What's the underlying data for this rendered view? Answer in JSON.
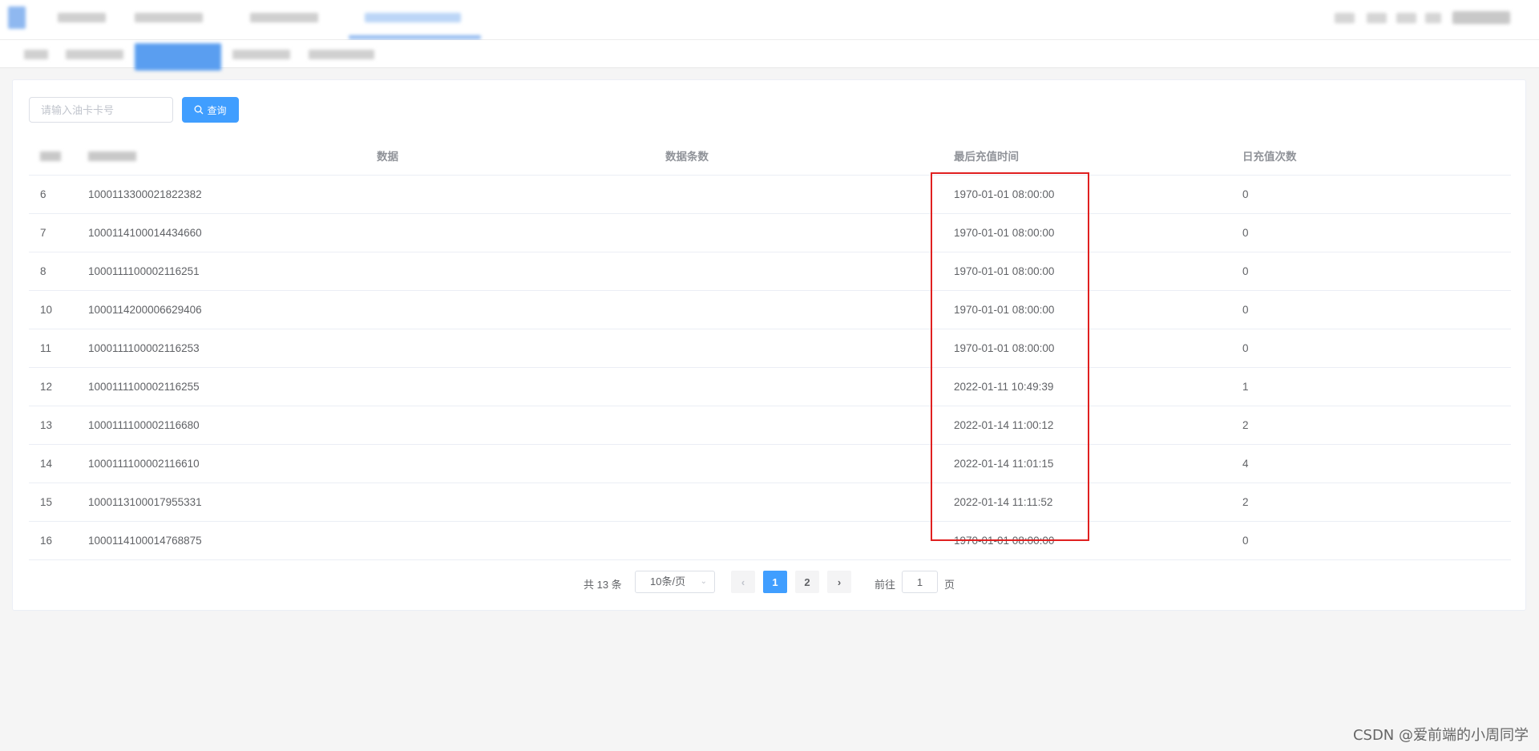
{
  "search": {
    "placeholder": "请输入油卡卡号",
    "button_label": "查询",
    "button_icon": "search-icon"
  },
  "table": {
    "columns": [
      "",
      "",
      "数据",
      "数据条数",
      "最后充值时间",
      "日充值次数"
    ],
    "rows": [
      {
        "index": "6",
        "card": "1000113300021822382",
        "data": "",
        "count": "",
        "last_time": "1970-01-01 08:00:00",
        "daily": "0"
      },
      {
        "index": "7",
        "card": "1000114100014434660",
        "data": "",
        "count": "",
        "last_time": "1970-01-01 08:00:00",
        "daily": "0"
      },
      {
        "index": "8",
        "card": "1000111100002116251",
        "data": "",
        "count": "",
        "last_time": "1970-01-01 08:00:00",
        "daily": "0"
      },
      {
        "index": "10",
        "card": "1000114200006629406",
        "data": "",
        "count": "",
        "last_time": "1970-01-01 08:00:00",
        "daily": "0"
      },
      {
        "index": "11",
        "card": "1000111100002116253",
        "data": "",
        "count": "",
        "last_time": "1970-01-01 08:00:00",
        "daily": "0"
      },
      {
        "index": "12",
        "card": "1000111100002116255",
        "data": "",
        "count": "",
        "last_time": "2022-01-11 10:49:39",
        "daily": "1"
      },
      {
        "index": "13",
        "card": "1000111100002116680",
        "data": "",
        "count": "",
        "last_time": "2022-01-14 11:00:12",
        "daily": "2"
      },
      {
        "index": "14",
        "card": "1000111100002116610",
        "data": "",
        "count": "",
        "last_time": "2022-01-14 11:01:15",
        "daily": "4"
      },
      {
        "index": "15",
        "card": "1000113100017955331",
        "data": "",
        "count": "",
        "last_time": "2022-01-14 11:11:52",
        "daily": "2"
      },
      {
        "index": "16",
        "card": "1000114100014768875",
        "data": "",
        "count": "",
        "last_time": "1970-01-01 08:00:00",
        "daily": "0"
      }
    ]
  },
  "pagination": {
    "total_text": "共 13 条",
    "page_size": "10条/页",
    "pages": [
      "1",
      "2"
    ],
    "current_page": "1",
    "goto_label": "前往",
    "goto_value": "1",
    "page_suffix": "页"
  },
  "watermark": "CSDN @爱前端的小周同学",
  "colors": {
    "primary": "#409eff",
    "highlight_box": "#e02020"
  }
}
